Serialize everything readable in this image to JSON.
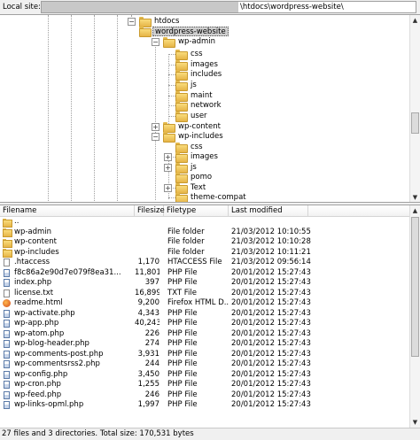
{
  "local_site": {
    "label": "Local site:",
    "path_suffix": "\\htdocs\\wordpress-website\\"
  },
  "tree": {
    "items": [
      {
        "label": "htdocs",
        "expander": "−"
      },
      {
        "label": "wordpress-website",
        "expander": "−",
        "selected": true
      },
      {
        "label": "wp-admin",
        "expander": "−"
      },
      {
        "label": "css",
        "expander": ""
      },
      {
        "label": "images",
        "expander": ""
      },
      {
        "label": "includes",
        "expander": ""
      },
      {
        "label": "js",
        "expander": ""
      },
      {
        "label": "maint",
        "expander": ""
      },
      {
        "label": "network",
        "expander": ""
      },
      {
        "label": "user",
        "expander": ""
      },
      {
        "label": "wp-content",
        "expander": "+"
      },
      {
        "label": "wp-includes",
        "expander": "−"
      },
      {
        "label": "css",
        "expander": ""
      },
      {
        "label": "images",
        "expander": "+"
      },
      {
        "label": "js",
        "expander": "+"
      },
      {
        "label": "pomo",
        "expander": ""
      },
      {
        "label": "Text",
        "expander": "+"
      },
      {
        "label": "theme-compat",
        "expander": ""
      }
    ]
  },
  "file_list": {
    "columns": {
      "filename": "Filename",
      "filesize": "Filesize",
      "filetype": "Filetype",
      "last_modified": "Last modified"
    },
    "rows": [
      {
        "icon": "folder-icon",
        "name": "..",
        "size": "",
        "type": "",
        "modified": ""
      },
      {
        "icon": "folder-icon",
        "name": "wp-admin",
        "size": "",
        "type": "File folder",
        "modified": "21/03/2012 10:10:55"
      },
      {
        "icon": "folder-icon",
        "name": "wp-content",
        "size": "",
        "type": "File folder",
        "modified": "21/03/2012 10:10:28"
      },
      {
        "icon": "folder-icon",
        "name": "wp-includes",
        "size": "",
        "type": "File folder",
        "modified": "21/03/2012 10:11:21"
      },
      {
        "icon": "file-icon",
        "name": ".htaccess",
        "size": "1,170",
        "type": "HTACCESS File",
        "modified": "21/03/2012 09:56:14"
      },
      {
        "icon": "php-file-icon",
        "name": "f8c86a2e90d7e079f8ea31...",
        "size": "11,801",
        "type": "PHP File",
        "modified": "20/01/2012 15:27:43"
      },
      {
        "icon": "php-file-icon",
        "name": "index.php",
        "size": "397",
        "type": "PHP File",
        "modified": "20/01/2012 15:27:43"
      },
      {
        "icon": "file-icon",
        "name": "license.txt",
        "size": "16,899",
        "type": "TXT File",
        "modified": "20/01/2012 15:27:43"
      },
      {
        "icon": "html-file-icon",
        "name": "readme.html",
        "size": "9,200",
        "type": "Firefox HTML D...",
        "modified": "20/01/2012 15:27:43"
      },
      {
        "icon": "php-file-icon",
        "name": "wp-activate.php",
        "size": "4,343",
        "type": "PHP File",
        "modified": "20/01/2012 15:27:43"
      },
      {
        "icon": "php-file-icon",
        "name": "wp-app.php",
        "size": "40,243",
        "type": "PHP File",
        "modified": "20/01/2012 15:27:43"
      },
      {
        "icon": "php-file-icon",
        "name": "wp-atom.php",
        "size": "226",
        "type": "PHP File",
        "modified": "20/01/2012 15:27:43"
      },
      {
        "icon": "php-file-icon",
        "name": "wp-blog-header.php",
        "size": "274",
        "type": "PHP File",
        "modified": "20/01/2012 15:27:43"
      },
      {
        "icon": "php-file-icon",
        "name": "wp-comments-post.php",
        "size": "3,931",
        "type": "PHP File",
        "modified": "20/01/2012 15:27:43"
      },
      {
        "icon": "php-file-icon",
        "name": "wp-commentsrss2.php",
        "size": "244",
        "type": "PHP File",
        "modified": "20/01/2012 15:27:43"
      },
      {
        "icon": "php-file-icon",
        "name": "wp-config.php",
        "size": "3,450",
        "type": "PHP File",
        "modified": "20/01/2012 15:27:43"
      },
      {
        "icon": "php-file-icon",
        "name": "wp-cron.php",
        "size": "1,255",
        "type": "PHP File",
        "modified": "20/01/2012 15:27:43"
      },
      {
        "icon": "php-file-icon",
        "name": "wp-feed.php",
        "size": "246",
        "type": "PHP File",
        "modified": "20/01/2012 15:27:43"
      },
      {
        "icon": "php-file-icon",
        "name": "wp-links-opml.php",
        "size": "1,997",
        "type": "PHP File",
        "modified": "20/01/2012 15:27:43"
      }
    ]
  },
  "status": "27 files and 3 directories. Total size: 170,531 bytes"
}
